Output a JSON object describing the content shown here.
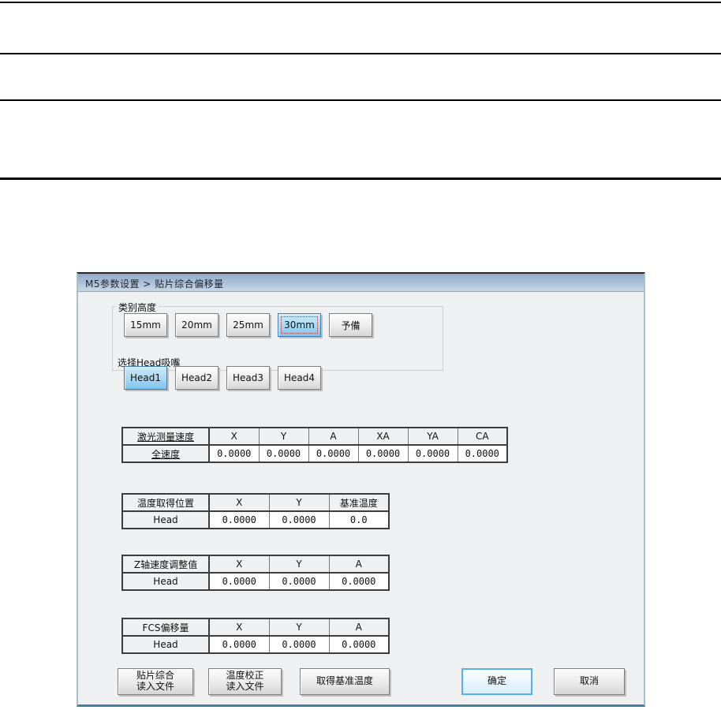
{
  "dialog": {
    "title": "M5参数设置 > 贴片综合偏移量",
    "selection": {
      "height": "30mm",
      "head": "Head1"
    },
    "groups": {
      "height": {
        "label": "类别高度",
        "buttons": [
          "15mm",
          "20mm",
          "25mm",
          "30mm",
          "予備"
        ]
      },
      "head": {
        "label": "选择Head吸嘴",
        "buttons": [
          "Head1",
          "Head2",
          "Head3",
          "Head4"
        ]
      }
    },
    "tables": {
      "laser": {
        "title": "激光测量速度",
        "columns": [
          "X",
          "Y",
          "A",
          "XA",
          "YA",
          "CA"
        ],
        "row_label": "全速度",
        "values": [
          "0.0000",
          "0.0000",
          "0.0000",
          "0.0000",
          "0.0000",
          "0.0000"
        ]
      },
      "temp": {
        "title": "温度取得位置",
        "columns": [
          "X",
          "Y",
          "基准温度"
        ],
        "row_label": "Head",
        "values": [
          "0.0000",
          "0.0000",
          "0.0"
        ]
      },
      "zaxis": {
        "title": "Z轴速度调整值",
        "columns": [
          "X",
          "Y",
          "A"
        ],
        "row_label": "Head",
        "values": [
          "0.0000",
          "0.0000",
          "0.0000"
        ]
      },
      "fcs": {
        "title": "FCS偏移量",
        "columns": [
          "X",
          "Y",
          "A"
        ],
        "row_label": "Head",
        "values": [
          "0.0000",
          "0.0000",
          "0.0000"
        ]
      }
    },
    "footer_buttons": {
      "load_placement": "贴片综合\n读入文件",
      "load_temp": "温度校正\n读入文件",
      "get_base_temp": "取得基准温度",
      "ok": "确定",
      "cancel": "取消"
    }
  }
}
